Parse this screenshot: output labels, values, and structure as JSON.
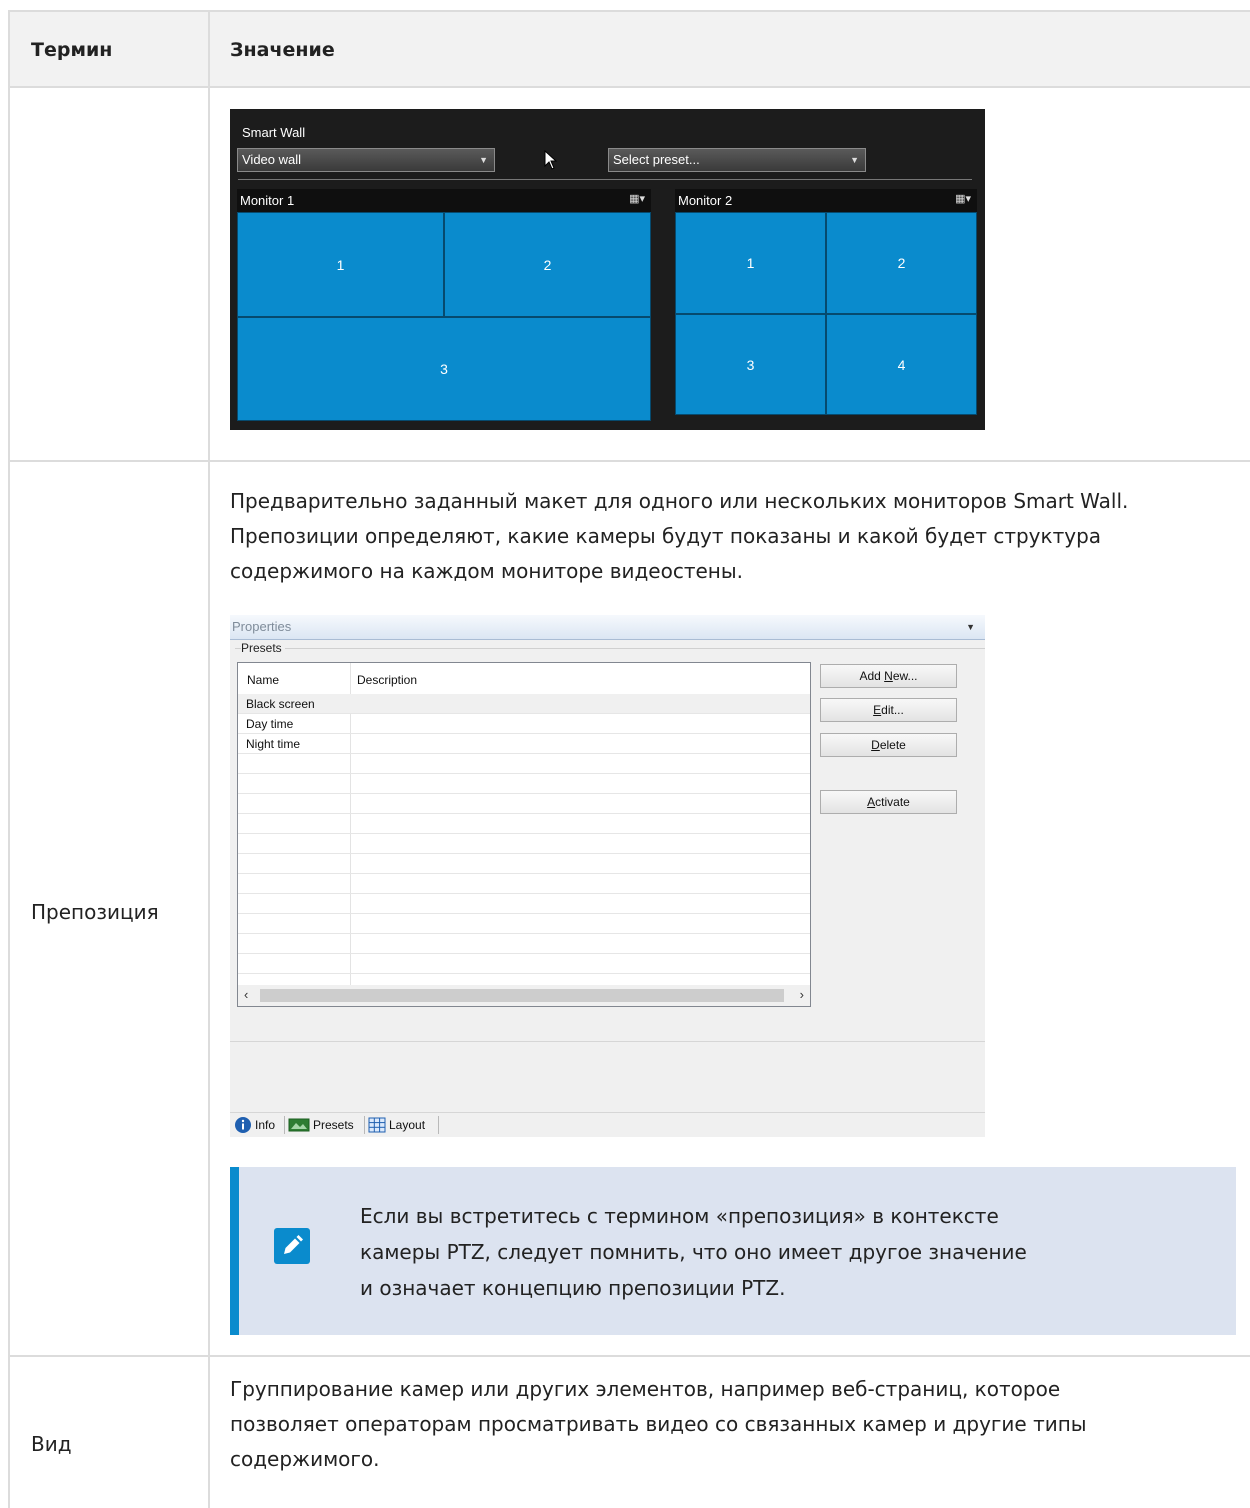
{
  "table": {
    "header": {
      "term": "Термин",
      "meaning": "Значение"
    },
    "rows": [
      {
        "term": ""
      },
      {
        "term": "Препозиция",
        "description": [
          "Предварительно заданный макет для одного или нескольких мониторов Smart Wall.",
          "Препозиции определяют, какие камеры будут показаны и какой будет структура",
          "содержимого на каждом мониторе видеостены."
        ],
        "note": [
          "Если вы встретитесь с термином «препозиция» в контексте",
          "камеры PTZ, следует помнить, что оно имеет другое значение",
          "и означает концепцию препозиции PTZ."
        ]
      },
      {
        "term": "Вид",
        "description": [
          "Группирование камер или других элементов, например веб-страниц, которое",
          "позволяет операторам просматривать видео со связанных камер и другие типы",
          "содержимого."
        ]
      }
    ]
  },
  "smart_wall": {
    "title": "Smart Wall",
    "wall_select": "Video wall",
    "preset_select": "Select preset...",
    "monitors": [
      {
        "name": "Monitor 1",
        "tiles": [
          "1",
          "2",
          "3"
        ]
      },
      {
        "name": "Monitor 2",
        "tiles": [
          "1",
          "2",
          "3",
          "4"
        ]
      }
    ],
    "tile_color": "#0a8bcd"
  },
  "properties": {
    "title": "Properties",
    "group": "Presets",
    "columns": [
      "Name",
      "Description"
    ],
    "rows": [
      "Black screen",
      "Day time",
      "Night time"
    ],
    "buttons": [
      {
        "pre": "Add ",
        "key": "N",
        "post": "ew..."
      },
      {
        "pre": "",
        "key": "E",
        "post": "dit..."
      },
      {
        "pre": "",
        "key": "D",
        "post": "elete"
      },
      {
        "pre": "",
        "key": "A",
        "post": "ctivate"
      }
    ],
    "tabs": [
      "Info",
      "Presets",
      "Layout"
    ]
  },
  "colors": {
    "accent": "#0a8bcd",
    "note_bg": "#dce3f0"
  }
}
